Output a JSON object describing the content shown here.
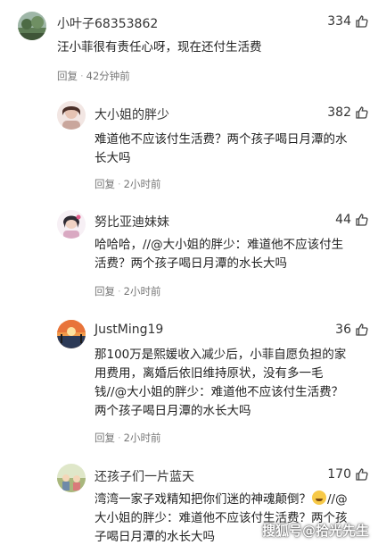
{
  "comments": [
    {
      "username": "小叶子68353862",
      "likes": "334",
      "text": "汪小菲很有责任心呀，现在还付生活费",
      "reply": "回复",
      "time": "42分钟前"
    },
    {
      "username": "大小姐的胖少",
      "likes": "382",
      "text": "难道他不应该付生活费？两个孩子喝日月潭的水长大吗",
      "reply": "回复",
      "time": "2小时前"
    },
    {
      "username": "努比亚迪妹妹",
      "likes": "44",
      "text": "哈哈哈，//@大小姐的胖少：难道他不应该付生活费？两个孩子喝日月潭的水长大吗",
      "reply": "回复",
      "time": "2小时前"
    },
    {
      "username": "JustMing19",
      "likes": "36",
      "text": "那100万是熙媛收入减少后，小菲自愿负担的家用费用，离婚后依旧维持原状，没有多一毛钱//@大小姐的胖少：难道他不应该付生活费？两个孩子喝日月潭的水长大吗",
      "reply": "回复",
      "time": "2小时前"
    },
    {
      "username": "还孩子们一片蓝天",
      "likes": "170",
      "text_before_emoji": "湾湾一家子戏精知把你们迷的神魂颠倒？",
      "text_after_emoji": "//@大小姐的胖少：难道他不应该付生活费？两个孩子喝日月潭的水长大吗"
    }
  ],
  "watermark": "搜狐号@拾光先生",
  "icons": {
    "like": "thumbs-up-icon",
    "emoji": "laughing-emoji-icon"
  },
  "colors": {
    "text": "#222222",
    "meta": "#777777",
    "background": "#ffffff"
  }
}
